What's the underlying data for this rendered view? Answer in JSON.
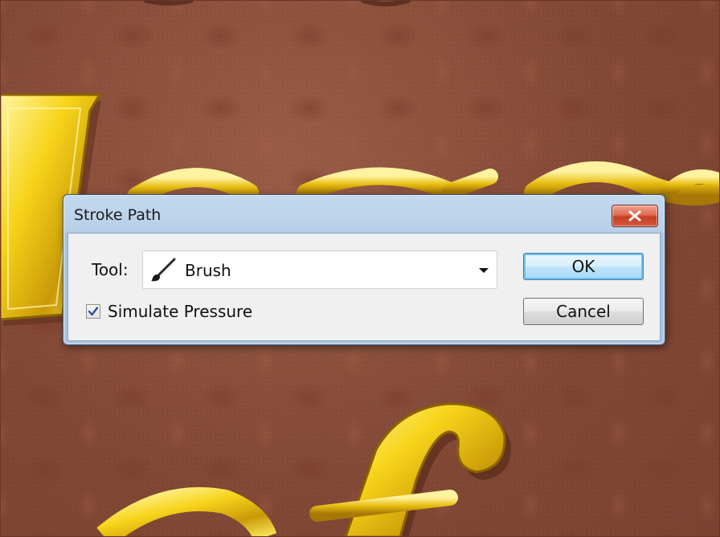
{
  "dialog": {
    "title": "Stroke Path",
    "close_icon": "close-x-icon",
    "tool_label": "Tool:",
    "tool_value": "Brush",
    "tool_icon": "brush-icon",
    "simulate_pressure_label": "Simulate Pressure",
    "simulate_pressure_checked": true,
    "ok_label": "OK",
    "cancel_label": "Cancel"
  },
  "colors": {
    "background": "#8b4d3a",
    "gold": "#f2d016",
    "titlebar": "#b7cfe8",
    "close_button": "#c63e23"
  }
}
